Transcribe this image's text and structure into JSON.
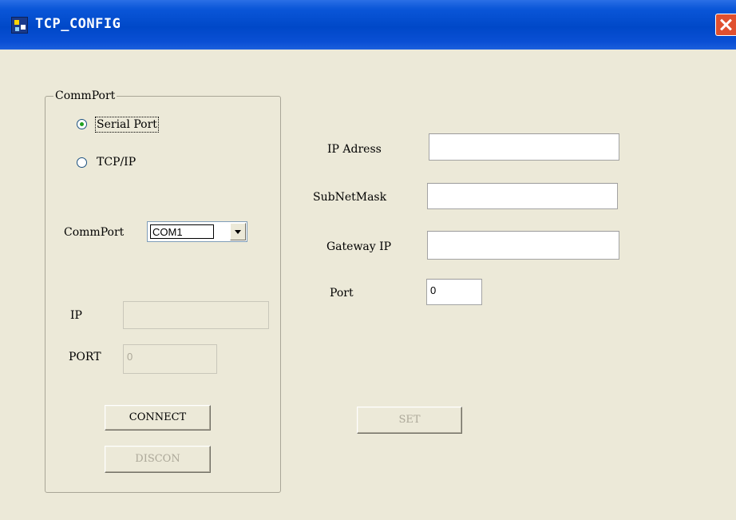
{
  "window": {
    "title": "TCP_CONFIG"
  },
  "commport_group": {
    "legend": "CommPort",
    "serial_port_label": "Serial Port",
    "serial_port_selected": true,
    "tcpip_label": "TCP/IP",
    "tcpip_selected": false,
    "commport_label": "CommPort",
    "commport_value": "COM1",
    "ip_label": "IP",
    "ip_value": "",
    "port_label": "PORT",
    "port_value": "0",
    "connect_label": "CONNECT",
    "discon_label": "DISCON"
  },
  "network": {
    "ip_address_label": "IP Adress",
    "ip_address_value": "",
    "subnet_label": "SubNetMask",
    "subnet_value": "",
    "gateway_label": "Gateway IP",
    "gateway_value": "",
    "port_label": "Port",
    "port_value": "0",
    "set_label": "SET"
  },
  "icons": {
    "app": "app-icon",
    "close": "close-icon",
    "dropdown": "chevron-down-icon"
  }
}
